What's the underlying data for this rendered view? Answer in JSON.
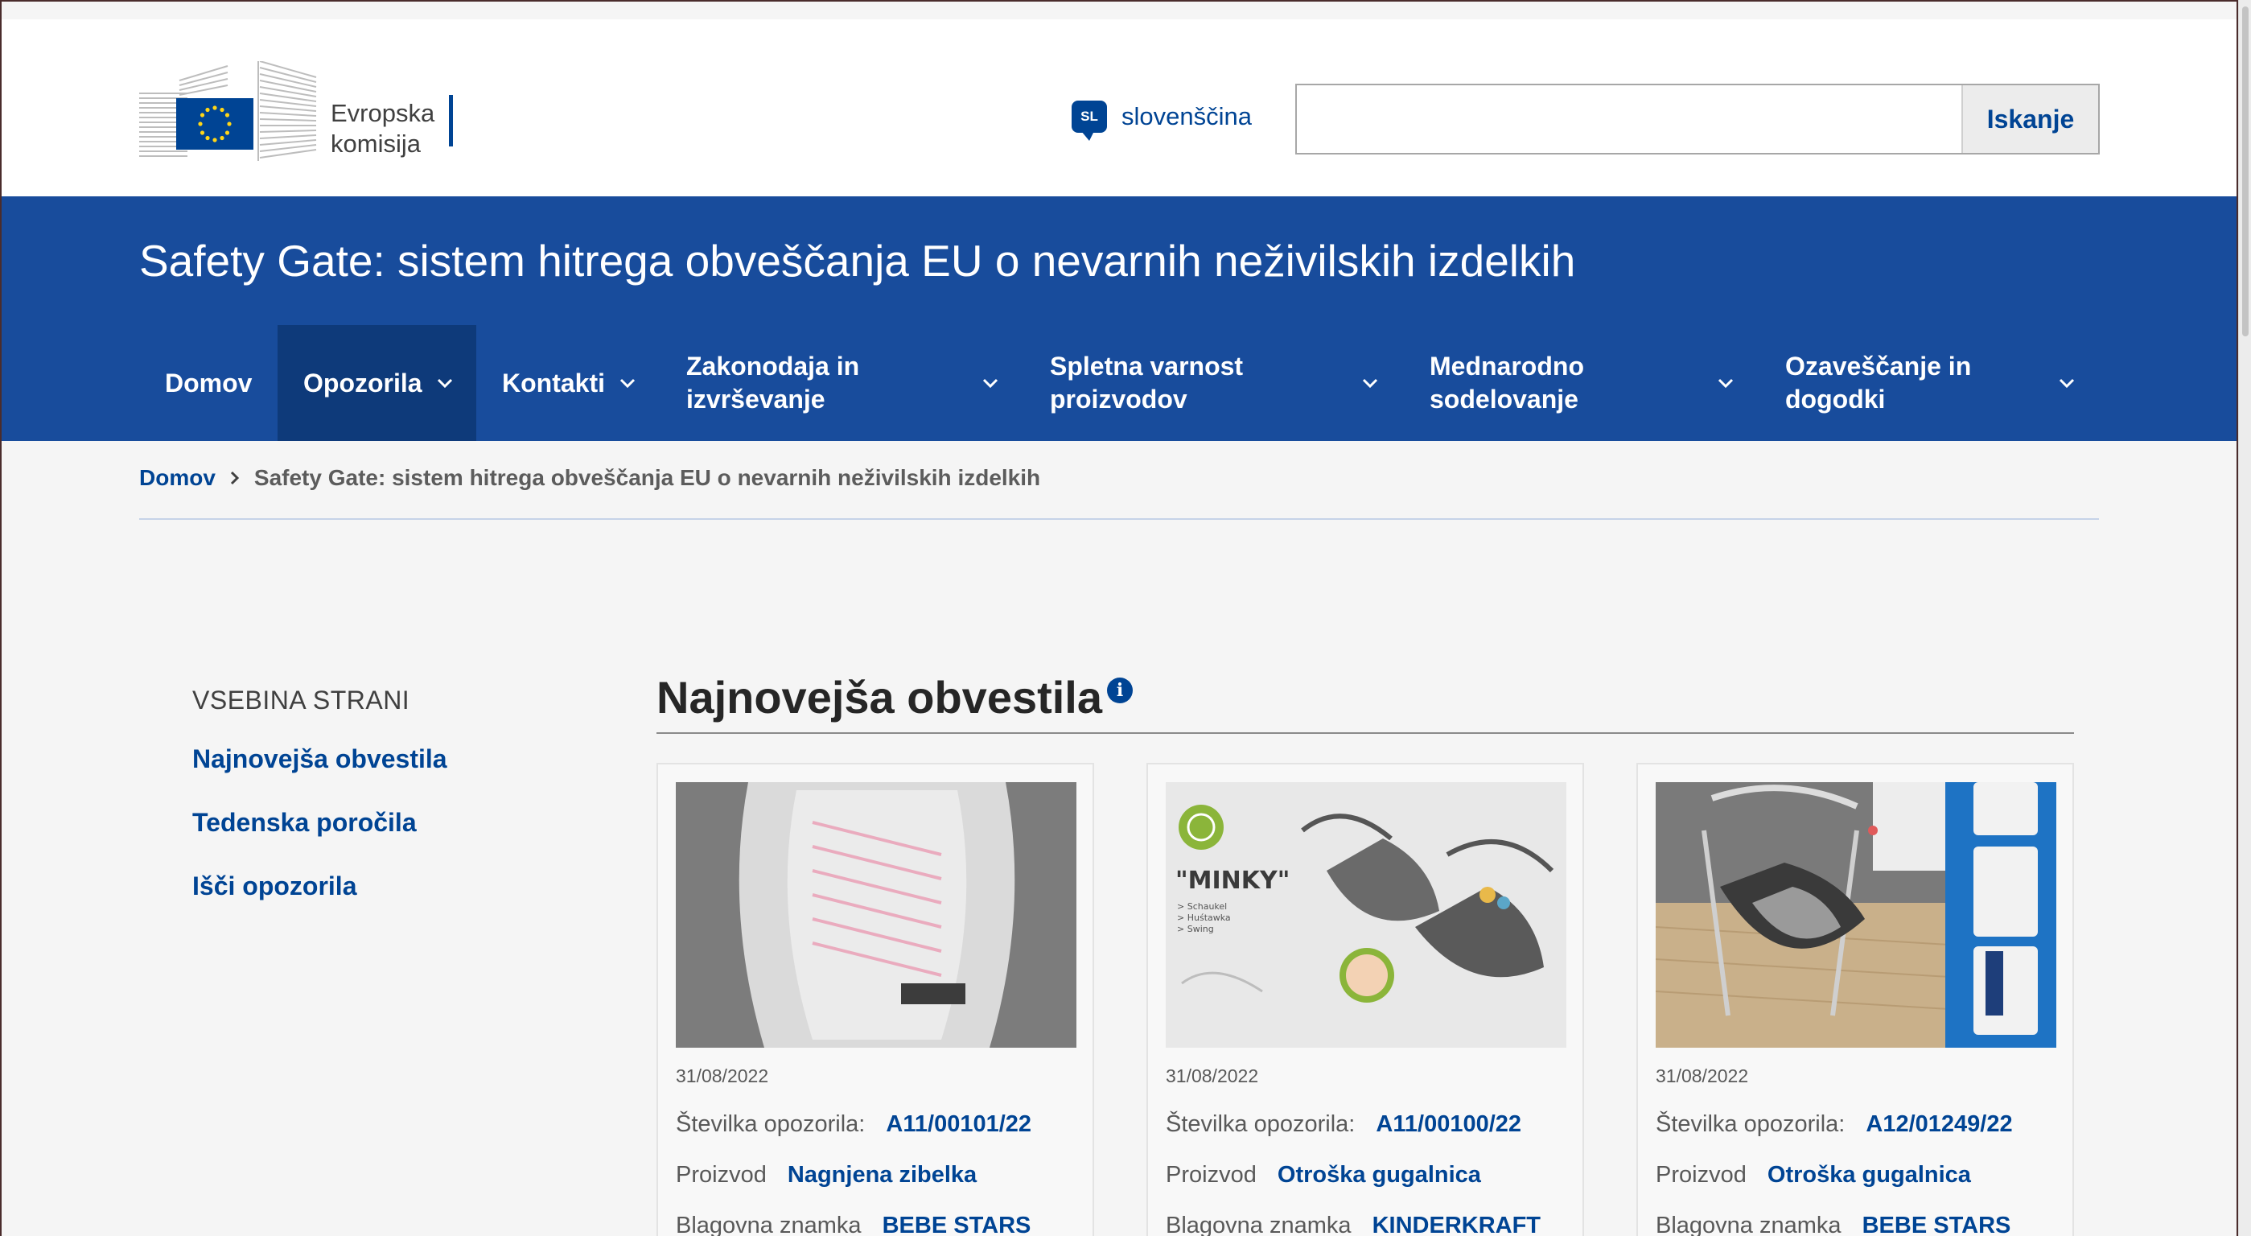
{
  "header": {
    "logo_line1": "Evropska",
    "logo_line2": "komisija",
    "language_code": "SL",
    "language_label": "slovenščina",
    "search_placeholder": "",
    "search_button": "Iskanje"
  },
  "site": {
    "title": "Safety Gate: sistem hitrega obveščanja EU o nevarnih neživilskih izdelkih"
  },
  "nav": [
    {
      "label": "Domov",
      "dropdown": false,
      "active": false
    },
    {
      "label": "Opozorila",
      "dropdown": true,
      "active": true
    },
    {
      "label": "Kontakti",
      "dropdown": true,
      "active": false
    },
    {
      "label_line1": "Zakonodaja in",
      "label_line2": "izvrševanje",
      "dropdown": true,
      "active": false
    },
    {
      "label_line1": "Spletna varnost",
      "label_line2": "proizvodov",
      "dropdown": true,
      "active": false
    },
    {
      "label_line1": "Mednarodno",
      "label_line2": "sodelovanje",
      "dropdown": true,
      "active": false
    },
    {
      "label_line1": "Ozaveščanje in",
      "label_line2": "dogodki",
      "dropdown": true,
      "active": false
    }
  ],
  "breadcrumb": {
    "home": "Domov",
    "current": "Safety Gate: sistem hitrega obveščanja EU o nevarnih neživilskih izdelkih"
  },
  "toc": {
    "title": "VSEBINA STRANI",
    "links": [
      "Najnovejša obvestila",
      "Tedenska poročila",
      "Išči opozorila"
    ]
  },
  "section": {
    "title": "Najnovejša obvestila",
    "info_icon": "info-icon"
  },
  "cards": [
    {
      "date": "31/08/2022",
      "alert_label": "Številka opozorila:",
      "alert_number": "A11/00101/22",
      "product_label": "Proizvod",
      "product": "Nagnjena zibelka",
      "brand_label": "Blagovna znamka",
      "brand": "BEBE STARS"
    },
    {
      "date": "31/08/2022",
      "alert_label": "Številka opozorila:",
      "alert_number": "A11/00100/22",
      "product_label": "Proizvod",
      "product": "Otroška gugalnica",
      "brand_label": "Blagovna znamka",
      "brand": "KINDERKRAFT",
      "image_text": {
        "title": "\"MINKY\"",
        "item1": "> Schaukel",
        "item2": "> Huśtawka",
        "item3": "> Swing"
      }
    },
    {
      "date": "31/08/2022",
      "alert_label": "Številka opozorila:",
      "alert_number": "A12/01249/22",
      "product_label": "Proizvod",
      "product": "Otroška gugalnica",
      "brand_label": "Blagovna znamka",
      "brand": "BEBE STARS"
    }
  ],
  "colors": {
    "primary_blue": "#004494",
    "band_blue": "#184c9c",
    "active_nav": "#0e3a7a"
  }
}
